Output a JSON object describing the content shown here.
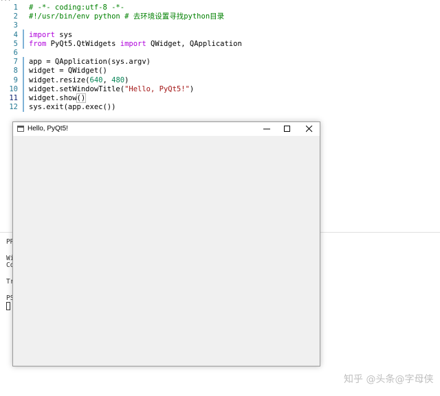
{
  "editor": {
    "breadcrumb": "...",
    "lines": [
      {
        "num": "1",
        "tokens": [
          {
            "t": "cmt",
            "text": "# -*- coding:utf-8 -*-"
          }
        ]
      },
      {
        "num": "2",
        "tokens": [
          {
            "t": "cmt",
            "text": "#!/usr/bin/env python # 去环境设置寻找python目录"
          }
        ]
      },
      {
        "num": "3",
        "tokens": []
      },
      {
        "num": "4",
        "tokens": [
          {
            "t": "kw",
            "text": "import"
          },
          {
            "t": "plain",
            "text": " sys"
          }
        ]
      },
      {
        "num": "5",
        "tokens": [
          {
            "t": "kw",
            "text": "from"
          },
          {
            "t": "plain",
            "text": " PyQt5.QtWidgets "
          },
          {
            "t": "kw",
            "text": "import"
          },
          {
            "t": "plain",
            "text": " QWidget, QApplication"
          }
        ]
      },
      {
        "num": "6",
        "tokens": []
      },
      {
        "num": "7",
        "tokens": [
          {
            "t": "plain",
            "text": "app = QApplication(sys.argv)"
          }
        ]
      },
      {
        "num": "8",
        "tokens": [
          {
            "t": "plain",
            "text": "widget = QWidget()"
          }
        ]
      },
      {
        "num": "9",
        "tokens": [
          {
            "t": "plain",
            "text": "widget.resize("
          },
          {
            "t": "num",
            "text": "640"
          },
          {
            "t": "plain",
            "text": ", "
          },
          {
            "t": "num",
            "text": "480"
          },
          {
            "t": "plain",
            "text": ")"
          }
        ]
      },
      {
        "num": "10",
        "tokens": [
          {
            "t": "plain",
            "text": "widget.setWindowTitle("
          },
          {
            "t": "str",
            "text": "\"Hello, PyQt5!\""
          },
          {
            "t": "plain",
            "text": ")"
          }
        ]
      },
      {
        "num": "11",
        "tokens": [
          {
            "t": "plain",
            "text": "widget.show"
          },
          {
            "t": "cursor",
            "text": "()"
          }
        ]
      },
      {
        "num": "12",
        "tokens": [
          {
            "t": "plain",
            "text": "sys.exit(app.exec())"
          }
        ]
      }
    ]
  },
  "terminal": {
    "lines": [
      "PR",
      "Wi",
      "Co",
      "Tr",
      "PS"
    ]
  },
  "window": {
    "title": "Hello, PyQt5!",
    "icon": "window-icon",
    "buttons": [
      "minimize-icon",
      "maximize-icon",
      "close-icon"
    ]
  },
  "watermark": {
    "text": "知乎 @头条@字母侠",
    "overlay": "头条@字母侠"
  },
  "colors": {
    "comment": "#008000",
    "keyword": "#af00db",
    "number": "#098658",
    "string": "#a31515",
    "line_number": "#237893",
    "window_background": "#f0f0f0"
  }
}
